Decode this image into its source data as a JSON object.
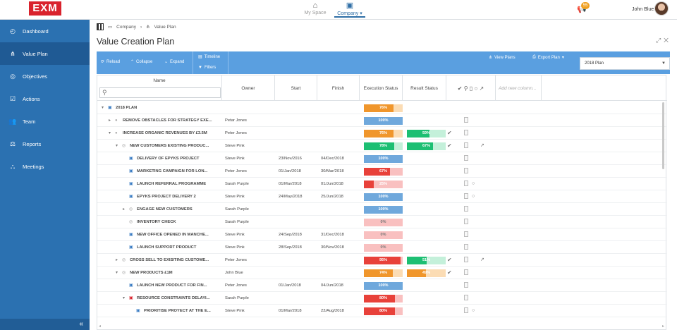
{
  "app": {
    "logo": "EXM",
    "nav": [
      {
        "label": "My Space",
        "icon": "home-icon"
      },
      {
        "label": "Company",
        "icon": "company-icon",
        "active": true
      }
    ],
    "notifications": "55",
    "user": "John Blue"
  },
  "sidebar": {
    "items": [
      {
        "label": "Dashboard",
        "icon": "dashboard-icon"
      },
      {
        "label": "Value Plan",
        "icon": "value-plan-icon",
        "active": true
      },
      {
        "label": "Objectives",
        "icon": "objectives-icon"
      },
      {
        "label": "Actions",
        "icon": "actions-icon"
      },
      {
        "label": "Team",
        "icon": "team-icon"
      },
      {
        "label": "Reports",
        "icon": "reports-icon"
      },
      {
        "label": "Meetings",
        "icon": "meetings-icon"
      }
    ],
    "collapse": "«"
  },
  "breadcrumb": {
    "items": [
      "Company",
      "Value Plan"
    ]
  },
  "page": {
    "title": "Value Creation Plan"
  },
  "toolbar": {
    "reload": "Reload",
    "collapse": "Collapse",
    "expand": "Expand",
    "timeline": "Timeline",
    "filters": "Filters",
    "view_plans": "View Plans",
    "export_plan": "Export Plan",
    "plan_select": "2018 Plan"
  },
  "columns": {
    "name": "Name",
    "owner": "Owner",
    "start": "Start",
    "finish": "Finish",
    "execution": "Execution Status",
    "result": "Result Status",
    "add_new": "Add new column..."
  },
  "colors": {
    "green": "#1dbf73",
    "orange": "#f0962c",
    "red": "#e8413a",
    "blue": "#6fa8dc",
    "pink": "#f9c0c0"
  },
  "rows": [
    {
      "name": "2018 PLAN",
      "level": 0,
      "exp": "▾",
      "tag": "plan",
      "exec": {
        "v": 76,
        "c": "orange"
      },
      "doc": false
    },
    {
      "name": "REMOVE OBSTACLES FOR STRATEGY EXE...",
      "level": 1,
      "exp": "▸",
      "tag": "dot",
      "owner": "Petar Jones",
      "exec": {
        "v": 100,
        "c": "blue"
      },
      "doc": true
    },
    {
      "name": "INCREASE ORGANIC REVENUES BY £3.5M",
      "level": 1,
      "exp": "▾",
      "tag": "dot",
      "owner": "Peter Jones",
      "exec": {
        "v": 76,
        "c": "orange"
      },
      "result": {
        "v": 59,
        "c": "green"
      },
      "check": true,
      "doc": true
    },
    {
      "name": "NEW CUSTOMERS EXISTING PRODUC...",
      "level": 2,
      "exp": "▾",
      "tag": "ring",
      "owner": "Steve Pink",
      "exec": {
        "v": 78,
        "c": "green"
      },
      "result": {
        "v": 67,
        "c": "green"
      },
      "check": true,
      "doc": true,
      "ext": true
    },
    {
      "name": "DELIVERY OF EPYKS PROJECT",
      "level": 3,
      "tag": "task",
      "owner": "Steve Pink",
      "start": "23/Nov/2016",
      "finish": "04/Dec/2018",
      "exec": {
        "v": 100,
        "c": "blue"
      },
      "doc": true
    },
    {
      "name": "MARKETING CAMPAIGN FOR LON...",
      "level": 3,
      "tag": "task",
      "owner": "Peter Jones",
      "start": "01/Jan/2018",
      "finish": "30/Mar/2018",
      "exec": {
        "v": 67,
        "c": "red"
      },
      "doc": true
    },
    {
      "name": "LAUNCH REFERRAL PROGRAMME",
      "level": 3,
      "tag": "task",
      "owner": "Sarah Purple",
      "start": "01/Mar/2018",
      "finish": "01/Jun/2018",
      "exec": {
        "v": 25,
        "c": "red"
      },
      "doc": true,
      "comment": true
    },
    {
      "name": "EPYKS PROJECT DELIVERY 2",
      "level": 3,
      "tag": "task",
      "owner": "Steve Pink",
      "start": "24/May/2018",
      "finish": "25/Jun/2018",
      "exec": {
        "v": 100,
        "c": "blue"
      },
      "doc": true,
      "comment": true
    },
    {
      "name": "ENGAGE NEW CUSTOMERS",
      "level": 3,
      "exp": "▸",
      "tag": "ring",
      "owner": "Sarah Purple",
      "exec": {
        "v": 100,
        "c": "blue"
      },
      "doc": true
    },
    {
      "name": "INVENTORY CHECK",
      "level": 3,
      "tag": "ring",
      "owner": "Sarah Purple",
      "exec": {
        "v": 0,
        "c": "red"
      },
      "doc": true
    },
    {
      "name": "NEW OFFICE OPENED IN MANCHE...",
      "level": 3,
      "tag": "task",
      "owner": "Steve Pink",
      "start": "24/Sep/2018",
      "finish": "31/Dec/2018",
      "exec": {
        "v": 0,
        "c": "red"
      },
      "doc": true
    },
    {
      "name": "LAUNCH SUPPORT PRODUCT",
      "level": 3,
      "tag": "task",
      "owner": "Steve Pink",
      "start": "28/Sep/2018",
      "finish": "30/Nov/2018",
      "exec": {
        "v": 0,
        "c": "red"
      },
      "doc": true
    },
    {
      "name": "CROSS SELL TO EXISITING CUSTOME...",
      "level": 2,
      "exp": "▸",
      "tag": "ring",
      "owner": "Peter Jones",
      "exec": {
        "v": 95,
        "c": "red"
      },
      "result": {
        "v": 51,
        "c": "green"
      },
      "check": true,
      "doc": true,
      "ext": true
    },
    {
      "name": "NEW PRODUCTS £1M",
      "level": 2,
      "exp": "▾",
      "tag": "ring",
      "owner": "John Blue",
      "exec": {
        "v": 74,
        "c": "orange"
      },
      "result": {
        "v": 49,
        "c": "orange"
      },
      "check": true,
      "doc": true
    },
    {
      "name": "LAUNCH NEW PRODUCT FOR FIN...",
      "level": 3,
      "tag": "task",
      "owner": "Peter Jones",
      "start": "01/Jan/2018",
      "finish": "04/Jun/2018",
      "exec": {
        "v": 100,
        "c": "blue"
      },
      "doc": true
    },
    {
      "name": "RESOURCE CONSTRAINTS DELAYI...",
      "level": 3,
      "exp": "▾",
      "tag": "risk",
      "owner": "Sarah Purple",
      "exec": {
        "v": 80,
        "c": "red"
      },
      "doc": true
    },
    {
      "name": "PRIORITISE PROYECT AT THE E...",
      "level": 4,
      "tag": "task",
      "owner": "Steve Pink",
      "start": "01/Mar/2018",
      "finish": "22/Aug/2018",
      "exec": {
        "v": 80,
        "c": "red"
      },
      "doc": true,
      "comment": true
    }
  ]
}
